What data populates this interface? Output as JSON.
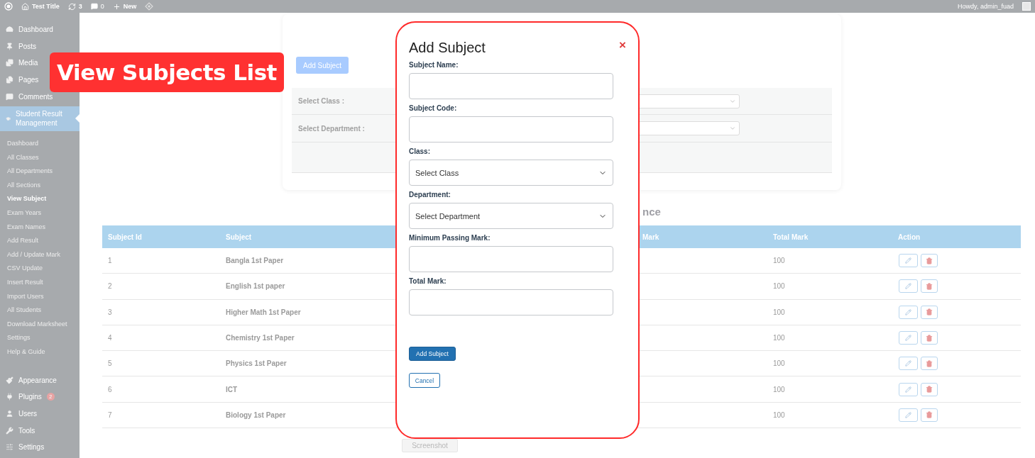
{
  "admin_bar": {
    "site_title": "Test Title",
    "updates": "3",
    "comments": "0",
    "new_label": "New",
    "greeting": "Howdy, admin_fuad"
  },
  "sidebar": {
    "items": [
      {
        "label": "Dashboard",
        "selected": false
      },
      {
        "label": "Posts",
        "selected": false
      },
      {
        "label": "Media",
        "selected": false
      },
      {
        "label": "Pages",
        "selected": false
      },
      {
        "label": "Comments",
        "selected": false
      },
      {
        "label": "Student Result Management",
        "selected": true,
        "children": [
          {
            "label": "Dashboard",
            "selected": false
          },
          {
            "label": "All Classes",
            "selected": false
          },
          {
            "label": "All Departments",
            "selected": false
          },
          {
            "label": "All Sections",
            "selected": false
          },
          {
            "label": "View Subject",
            "selected": true
          },
          {
            "label": "Exam Years",
            "selected": false
          },
          {
            "label": "Exam Names",
            "selected": false
          },
          {
            "label": "Add Result",
            "selected": false
          },
          {
            "label": "Add / Update Mark",
            "selected": false
          },
          {
            "label": "CSV Update",
            "selected": false
          },
          {
            "label": "Insert Result",
            "selected": false
          },
          {
            "label": "Import Users",
            "selected": false
          },
          {
            "label": "All Students",
            "selected": false
          },
          {
            "label": "Download Marksheet",
            "selected": false
          },
          {
            "label": "Settings",
            "selected": false
          },
          {
            "label": "Help & Guide",
            "selected": false
          }
        ]
      },
      {
        "label": "Appearance",
        "selected": false
      },
      {
        "label": "Plugins",
        "selected": false,
        "badge": "2"
      },
      {
        "label": "Users",
        "selected": false
      },
      {
        "label": "Tools",
        "selected": false
      },
      {
        "label": "Settings",
        "selected": false
      }
    ]
  },
  "banner": "View Subjects List",
  "filter": {
    "add_button": "Add Subject",
    "rows": [
      {
        "label": "Select Class :"
      },
      {
        "label": "Select Department :"
      }
    ]
  },
  "section_heading": "nce",
  "table": {
    "columns": [
      "Subject Id",
      "Subject",
      "Mark",
      "Total Mark",
      "Action"
    ],
    "rows": [
      {
        "id": "1",
        "subject": "Bangla 1st Paper",
        "total": "100"
      },
      {
        "id": "2",
        "subject": "English 1st paper",
        "total": "100"
      },
      {
        "id": "3",
        "subject": "Higher Math 1st Paper",
        "total": "100"
      },
      {
        "id": "4",
        "subject": "Chemistry 1st Paper",
        "total": "100"
      },
      {
        "id": "5",
        "subject": "Physics 1st Paper",
        "total": "100"
      },
      {
        "id": "6",
        "subject": "ICT",
        "total": "100"
      },
      {
        "id": "7",
        "subject": "Biology 1st Paper",
        "total": "100"
      }
    ]
  },
  "modal": {
    "title": "Add Subject",
    "close": "×",
    "fields": [
      {
        "kind": "text",
        "label": "Subject Name:"
      },
      {
        "kind": "text",
        "label": "Subject Code:"
      },
      {
        "kind": "select",
        "label": "Class:",
        "placeholder": "Select Class"
      },
      {
        "kind": "select",
        "label": "Department:",
        "placeholder": "Select Department"
      },
      {
        "kind": "text",
        "label": "Minimum Passing Mark:"
      },
      {
        "kind": "text",
        "label": "Total Mark:"
      }
    ],
    "submit": "Add Subject",
    "cancel": "Cancel"
  },
  "footer_button": "Screenshot"
}
